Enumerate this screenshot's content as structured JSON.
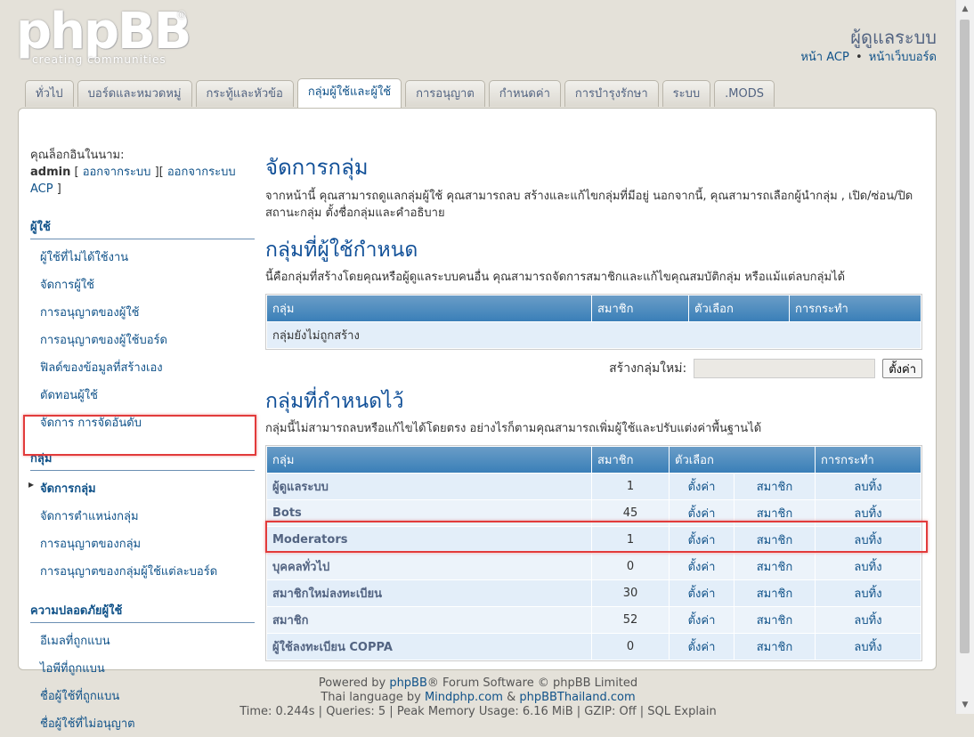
{
  "header": {
    "logo_text": "phpBB",
    "logo_tagline": "creating communities",
    "site_title": "ผู้ดูแลระบบ",
    "link_acp": "หน้า ACP",
    "link_sep": "•",
    "link_board": "หน้าเว็บบอร์ด"
  },
  "tabs": [
    {
      "label": "ทั่วไป"
    },
    {
      "label": "บอร์ดและหมวดหมู่"
    },
    {
      "label": "กระทู้และหัวข้อ"
    },
    {
      "label": "กลุ่มผู้ใช้และผู้ใช้"
    },
    {
      "label": "การอนุญาต"
    },
    {
      "label": "กำหนดค่า"
    },
    {
      "label": "การบำรุงรักษา"
    },
    {
      "label": "ระบบ"
    },
    {
      "label": ".MODS"
    }
  ],
  "sidebar": {
    "logged_as": "คุณล็อกอินในนาม:",
    "username": "admin",
    "logout_link": "ออกจากระบบ",
    "logout_acp_link": "ออกจากระบบ ACP",
    "sections": [
      {
        "title": "ผู้ใช้",
        "items": [
          {
            "label": "ผู้ใช้ที่ไม่ได้ใช้งาน"
          },
          {
            "label": "จัดการผู้ใช้"
          },
          {
            "label": "การอนุญาตของผู้ใช้"
          },
          {
            "label": "การอนุญาตของผู้ใช้บอร์ด"
          },
          {
            "label": "ฟิลด์ของข้อมูลที่สร้างเอง"
          },
          {
            "label": "ตัดทอนผู้ใช้"
          },
          {
            "label": "จัดการ การจัดอันดับ"
          }
        ]
      },
      {
        "title": "กลุ่ม",
        "items": [
          {
            "label": "จัดการกลุ่ม"
          },
          {
            "label": "จัดการตำแหน่งกลุ่ม"
          },
          {
            "label": "การอนุญาตของกลุ่ม"
          },
          {
            "label": "การอนุญาตของกลุ่มผู้ใช้แต่ละบอร์ด"
          }
        ]
      },
      {
        "title": "ความปลอดภัยผู้ใช้",
        "items": [
          {
            "label": "อีเมลที่ถูกแบน"
          },
          {
            "label": "ไอพีที่ถูกแบน"
          },
          {
            "label": "ชื่อผู้ใช้ที่ถูกแบน"
          },
          {
            "label": "ชื่อผู้ใช้ที่ไม่อนุญาต"
          }
        ]
      }
    ]
  },
  "main": {
    "title": "จัดการกลุ่ม",
    "description": "จากหน้านี้ คุณสามารถดูแลกลุ่มผู้ใช้ คุณสามารถลบ สร้างและแก้ไขกลุ่มที่มีอยู่ นอกจากนี้, คุณสามารถเลือกผู้นำกลุ่ม , เปิด/ซ่อน/ปิด สถานะกลุ่ม ตั้งชื่อกลุ่มและคำอธิบาย",
    "user_groups": {
      "title": "กลุ่มที่ผู้ใช้กำหนด",
      "description": "นี้คือกลุ่มที่สร้างโดยคุณหรือผู้ดูแลระบบคนอื่น คุณสามารถจัดการสมาชิกและแก้ไขคุณสมบัติกลุ่ม หรือแม้แต่ลบกลุ่มได้",
      "columns": [
        "กลุ่ม",
        "สมาชิก",
        "ตัวเลือก",
        "การกระทำ"
      ],
      "empty_text": "กลุ่มยังไม่ถูกสร้าง",
      "create_label": "สร้างกลุ่มใหม่:",
      "create_value": "",
      "create_button": "ตั้งค่า"
    },
    "predefined_groups": {
      "title": "กลุ่มที่กำหนดไว้",
      "description": "กลุ่มนี้ไม่สามารถลบหรือแก้ไขได้โดยตรง อย่างไรก็ตามคุณสามารถเพิ่มผู้ใช้และปรับแต่งค่าพื้นฐานได้",
      "columns": [
        "กลุ่ม",
        "สมาชิก",
        "ตัวเลือก",
        "การกระทำ"
      ],
      "rows": [
        {
          "name": "ผู้ดูแลระบบ",
          "members": "1",
          "settings": "ตั้งค่า",
          "membership": "สมาชิก",
          "delete": "ลบทิ้ง"
        },
        {
          "name": "Bots",
          "members": "45",
          "settings": "ตั้งค่า",
          "membership": "สมาชิก",
          "delete": "ลบทิ้ง"
        },
        {
          "name": "Moderators",
          "members": "1",
          "settings": "ตั้งค่า",
          "membership": "สมาชิก",
          "delete": "ลบทิ้ง"
        },
        {
          "name": "บุคคลทั่วไป",
          "members": "0",
          "settings": "ตั้งค่า",
          "membership": "สมาชิก",
          "delete": "ลบทิ้ง"
        },
        {
          "name": "สมาชิกใหม่ลงทะเบียน",
          "members": "30",
          "settings": "ตั้งค่า",
          "membership": "สมาชิก",
          "delete": "ลบทิ้ง"
        },
        {
          "name": "สมาชิก",
          "members": "52",
          "settings": "ตั้งค่า",
          "membership": "สมาชิก",
          "delete": "ลบทิ้ง"
        },
        {
          "name": "ผู้ใช้ลงทะเบียน COPPA",
          "members": "0",
          "settings": "ตั้งค่า",
          "membership": "สมาชิก",
          "delete": "ลบทิ้ง"
        }
      ]
    }
  },
  "footer": {
    "line1_pre": "Powered by ",
    "line1_link": "phpBB",
    "line1_post": "® Forum Software © phpBB Limited",
    "line2_pre": "Thai language by ",
    "line2_link1": "Mindphp.com",
    "line2_amp": " & ",
    "line2_link2": "phpBBThailand.com",
    "line3": "Time: 0.244s | Queries: 5 | Peak Memory Usage: 6.16 MiB | GZIP: Off | SQL Explain"
  },
  "colors": {
    "highlight": "#e23b3b",
    "accent": "#105289",
    "table_header": "#3a7fb8"
  }
}
